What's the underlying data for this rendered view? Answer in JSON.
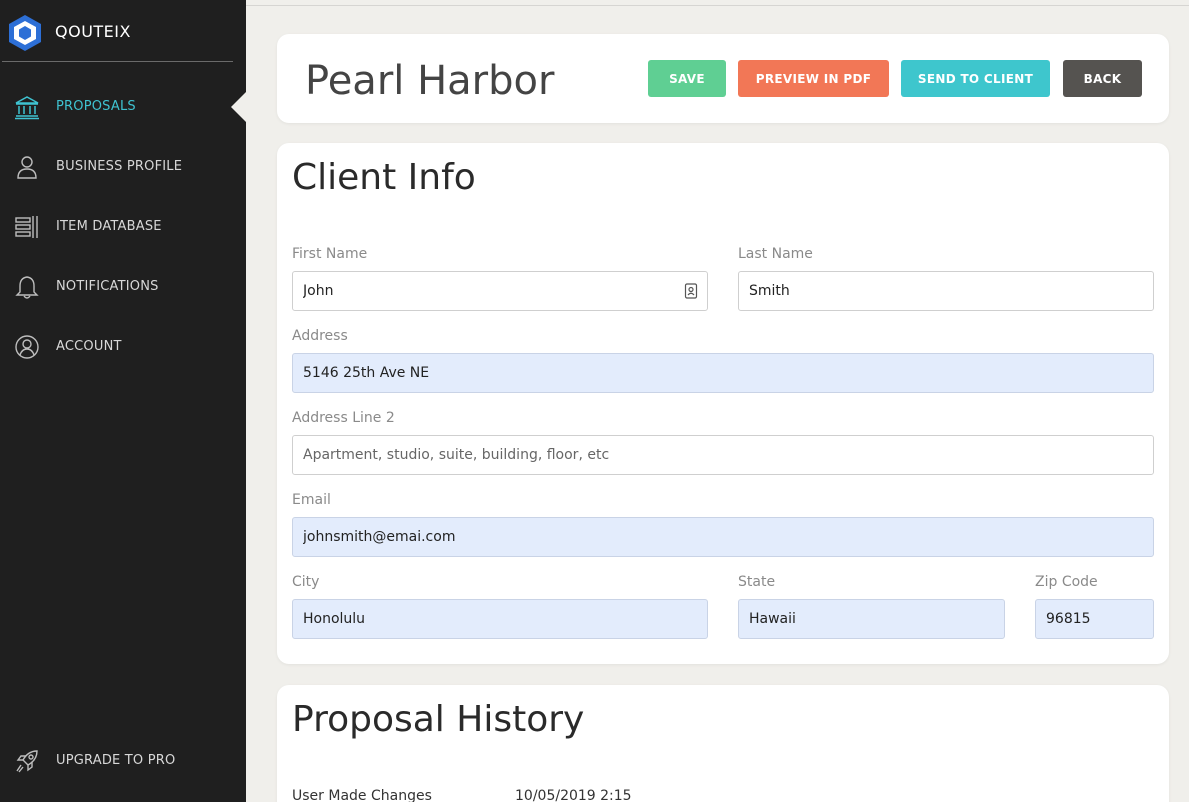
{
  "brand": {
    "name": "QOUTEIX"
  },
  "sidebar": {
    "items": [
      {
        "label": "PROPOSALS",
        "icon": "bank-icon",
        "active": true
      },
      {
        "label": "BUSINESS PROFILE",
        "icon": "user-icon"
      },
      {
        "label": "ITEM DATABASE",
        "icon": "database-icon"
      },
      {
        "label": "NOTIFICATIONS",
        "icon": "bell-icon"
      },
      {
        "label": "ACCOUNT",
        "icon": "account-circle-icon"
      }
    ],
    "upgrade": {
      "label": "UPGRADE TO PRO",
      "icon": "rocket-icon"
    }
  },
  "header": {
    "title": "Pearl Harbor",
    "buttons": {
      "save": "SAVE",
      "preview": "PREVIEW IN PDF",
      "send": "SEND TO CLIENT",
      "back": "BACK"
    }
  },
  "client_info": {
    "title": "Client Info",
    "first_name": {
      "label": "First Name",
      "value": "John"
    },
    "last_name": {
      "label": "Last Name",
      "value": "Smith"
    },
    "address": {
      "label": "Address",
      "value": "5146 25th Ave NE"
    },
    "address2": {
      "label": "Address Line 2",
      "placeholder": "Apartment, studio, suite, building, floor, etc"
    },
    "email": {
      "label": "Email",
      "value": "johnsmith@emai.com"
    },
    "city": {
      "label": "City",
      "value": "Honolulu"
    },
    "state": {
      "label": "State",
      "value": "Hawaii"
    },
    "zip": {
      "label": "Zip Code",
      "value": "96815"
    }
  },
  "proposal_history": {
    "title": "Proposal History",
    "entries": [
      {
        "event": "User Made Changes",
        "date": "10/05/2019 2:15"
      }
    ]
  },
  "colors": {
    "sidebar_bg": "#1f1f1f",
    "accent": "#3fc3d1",
    "save": "#5fcf93",
    "preview": "#f27756",
    "send": "#3ec6cd",
    "back": "#555350",
    "filled_field": "#e3ecfc"
  }
}
